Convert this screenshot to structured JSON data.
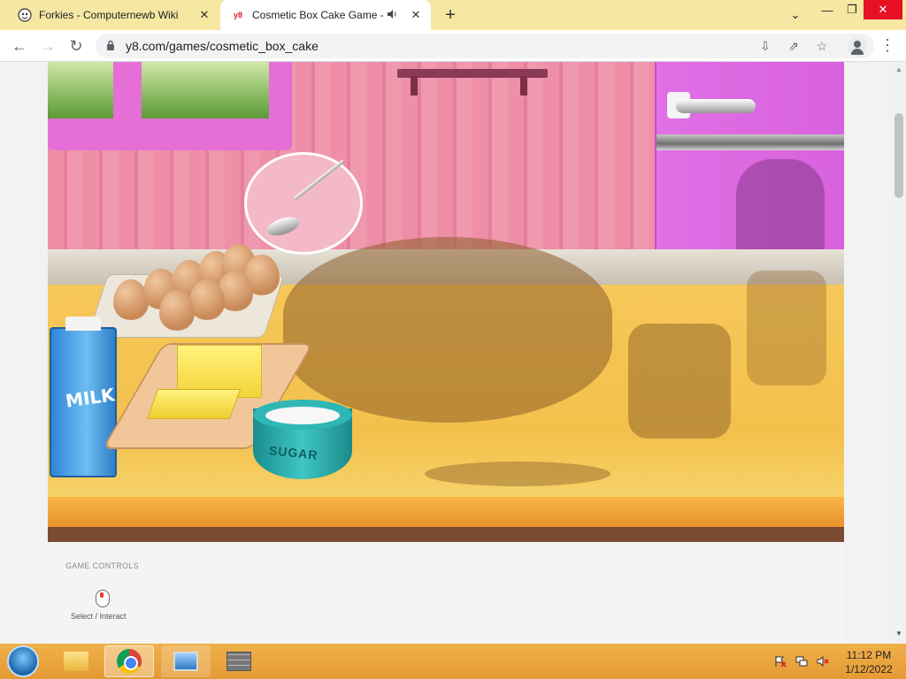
{
  "browser": {
    "tabs": [
      {
        "title": "Forkies - Computernewb Wiki",
        "close": "✕"
      },
      {
        "title": "Cosmetic Box Cake Game - P",
        "favicon_text": "y8",
        "close": "✕"
      }
    ],
    "new_tab": "+",
    "window": {
      "tab_search": "⌄",
      "minimize": "—",
      "maximize": "❐",
      "close": "✕"
    },
    "toolbar": {
      "back": "←",
      "forward": "→",
      "reload": "↻",
      "url": "y8.com/games/cosmetic_box_cake",
      "install": "⇩",
      "share": "⇗",
      "star": "☆",
      "menu": "⋮"
    }
  },
  "game": {
    "milk_label": "MILK",
    "sugar_label": "SUGAR"
  },
  "controls": {
    "title": "GAME CONTROLS",
    "items": [
      {
        "icon": "mouse-icon",
        "label": "Select / Interact"
      }
    ]
  },
  "scrollbar": {
    "up": "▲",
    "down": "▼"
  },
  "taskbar": {
    "time": "11:12 PM",
    "date": "1/12/2022"
  },
  "colors": {
    "tabstrip": "#f6e7a3",
    "taskbar": "#e49a34",
    "counter": "#f3c04b",
    "wall": "#ee8ea7",
    "fridge": "#e16fe6",
    "close_red": "#e81123"
  }
}
